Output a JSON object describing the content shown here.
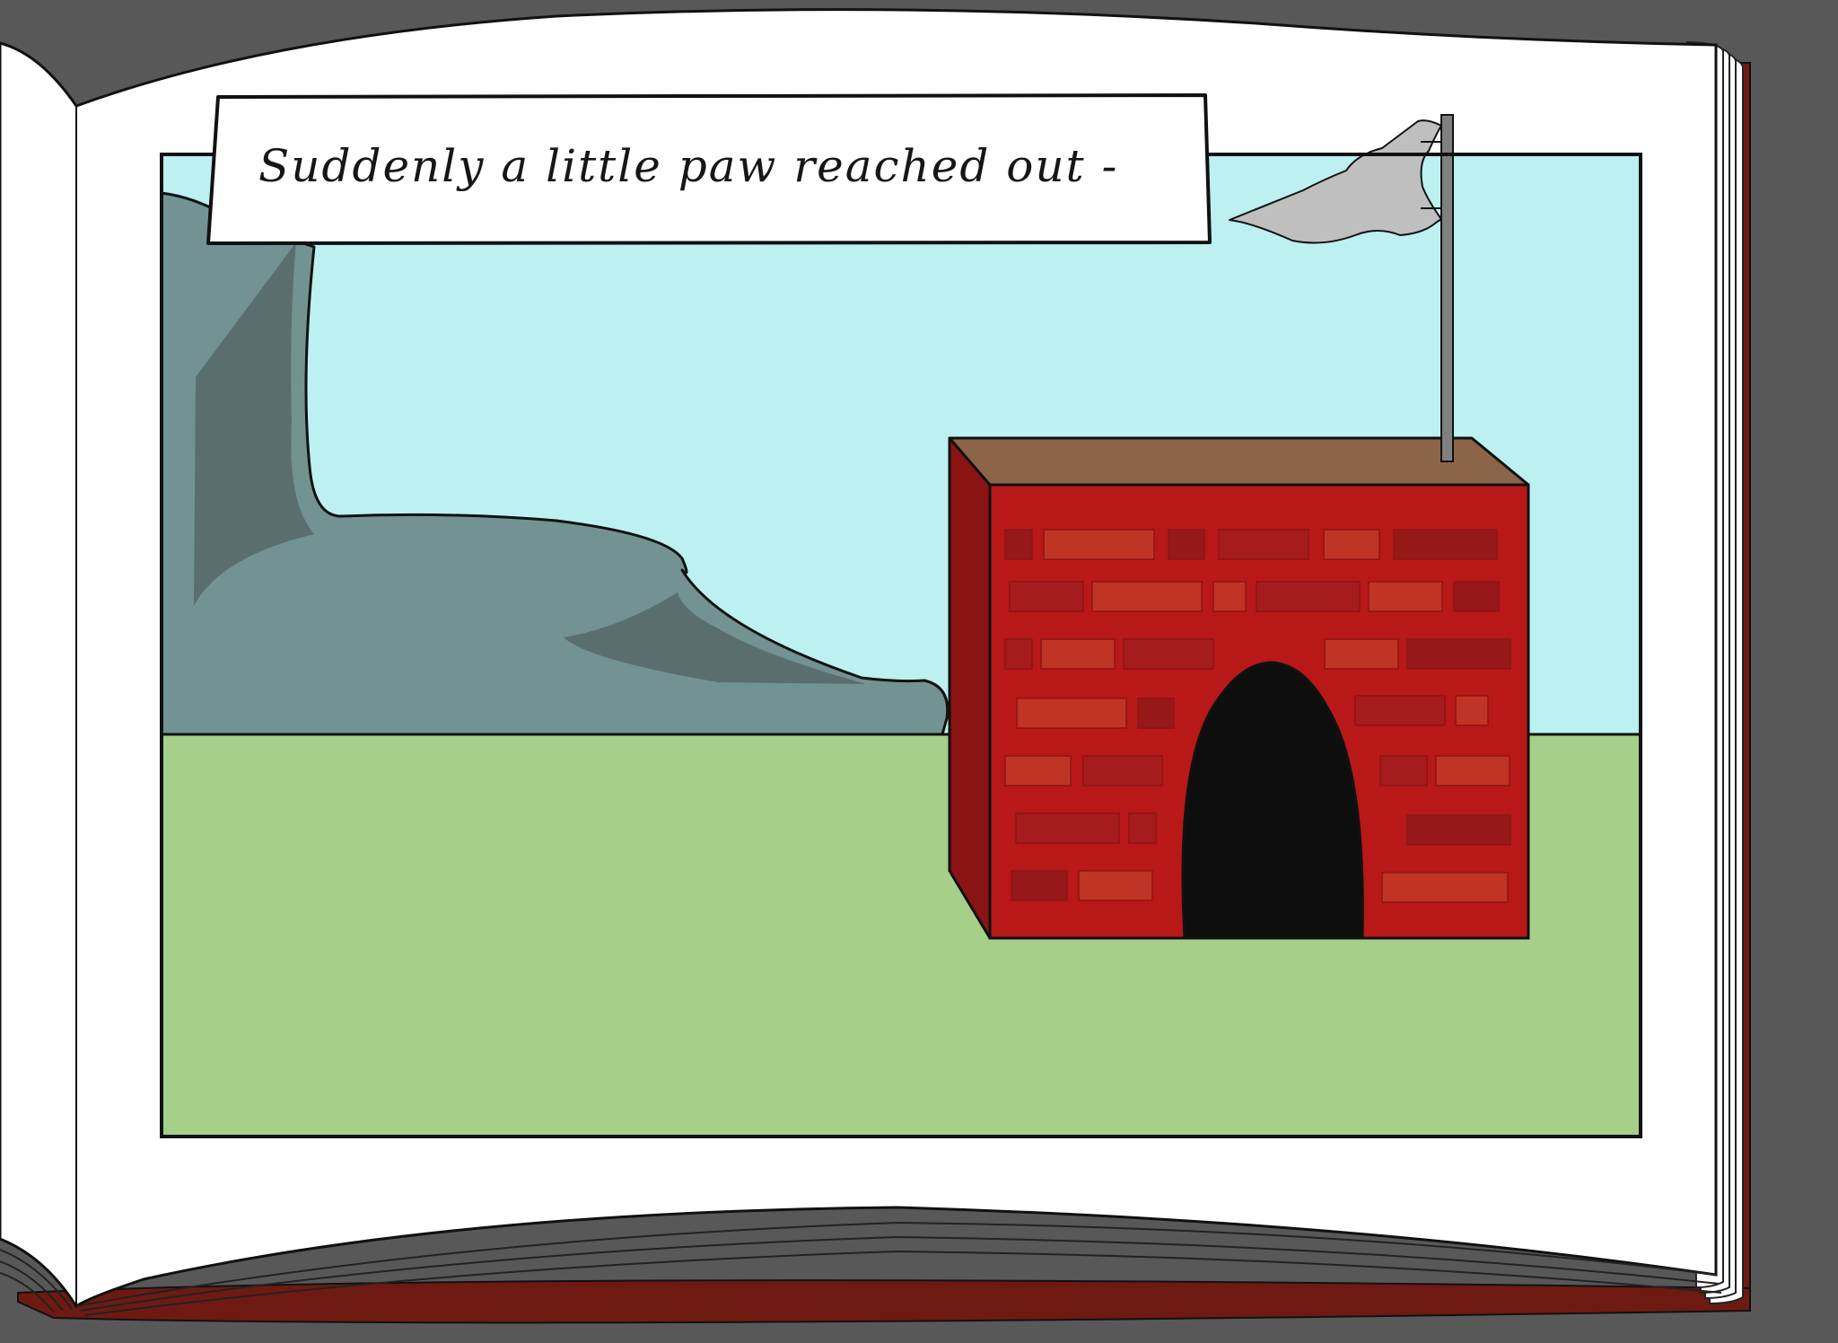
{
  "caption": {
    "text": "Suddenly a little paw reached out -"
  },
  "colors": {
    "background": "#595859",
    "page": "#ffffff",
    "book_cover": "#6e1a12",
    "sky": "#bdf0f0",
    "grass": "#a6cf8a",
    "mountain": "#739292",
    "mountain_shadow": "#5b6e6e",
    "brick_wall": "#b81818",
    "brick_side": "#8a1414",
    "roof": "#8c644a",
    "door": "#0e0e0e",
    "flag": "#bfbfbf",
    "flagpole": "#808080"
  },
  "icons": [
    "book-icon",
    "flag-icon",
    "doghouse-icon",
    "mountain-icon"
  ]
}
